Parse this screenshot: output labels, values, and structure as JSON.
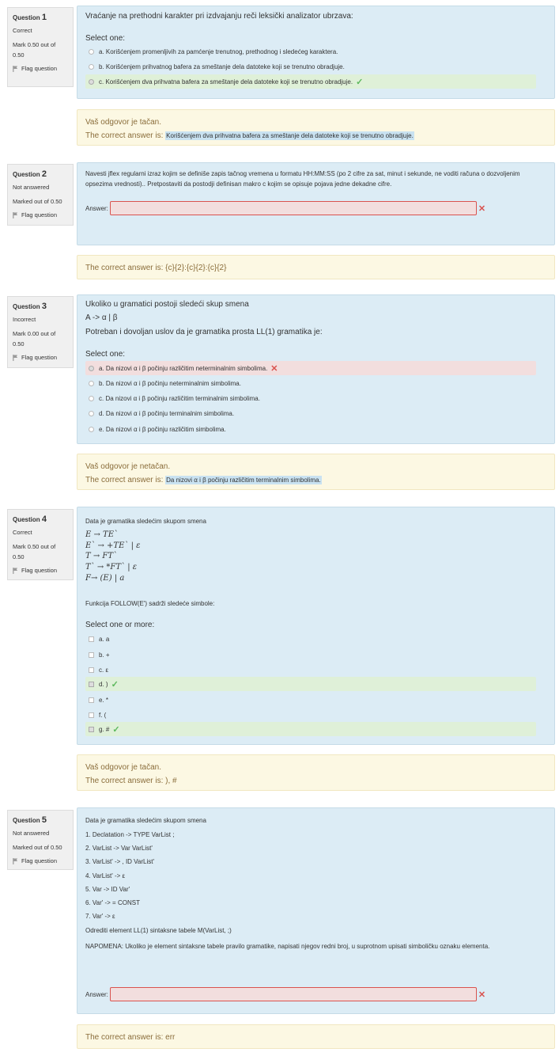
{
  "flag_label": "Flag question",
  "answer_label": "Answer:",
  "q1": {
    "label": "Question",
    "num": "1",
    "state": "Correct",
    "grade": "Mark 0.50 out of 0.50",
    "text": "Vraćanje na prethodni karakter pri izdvajanju reči leksički analizator ubrzava:",
    "select": "Select one:",
    "options": [
      "a. Korišćenjem promenljivih za pamćenje trenutnog, prethodnog i sledećeg karaktera.",
      "b. Korišćenjem prihvatnog bafera za smeštanje dela datoteke koji se trenutno obradjuje.",
      "c. Korišćenjem dva prihvatna bafera za smeštanje dela datoteke koji se trenutno obradjuje."
    ],
    "feedback": "Vaš odgovor je tačan.",
    "correct_prefix": "The correct answer is:",
    "correct": "Korišćenjem dva prihvatna bafera za smeštanje dela datoteke koji se trenutno obradjuje."
  },
  "q2": {
    "label": "Question",
    "num": "2",
    "state": "Not answered",
    "grade": "Marked out of 0.50",
    "text": "Navesti jflex regularni izraz kojim se definiše zapis tačnog vremena u formatu HH:MM:SS (po 2 cifre za sat, minut i sekunde, ne voditi računa o dozvoljenim opsezima vrednosti).. Pretpostaviti da postodji definisan makro c kojim se opisuje pojava jedne dekadne cifre.",
    "correct_full": "The correct answer is: {c}{2}:{c}{2}:{c}{2}"
  },
  "q3": {
    "label": "Question",
    "num": "3",
    "state": "Incorrect",
    "grade": "Mark 0.00 out of 0.50",
    "text1": "Ukoliko u gramatici postoji sledeći skup smena",
    "text2": "A -> α | β",
    "text3": "Potreban i dovoljan uslov da je gramatika prosta LL(1) gramatika je:",
    "select": "Select one:",
    "options": [
      "a. Da nizovi α i β počinju različitim neterminalnim simbolima.",
      "b. Da nizovi α i β počinju neterminalnim simbolima.",
      "c. Da nizovi α i β počinju različitim terminalnim simbolima.",
      "d. Da nizovi α i β počinju terminalnim simbolima.",
      "e. Da nizovi α i β počinju različitim simbolima."
    ],
    "feedback": "Vaš odgovor je netačan.",
    "correct_prefix": "The correct answer is:",
    "correct": "Da nizovi α i β počinju različitim terminalnim simbolima."
  },
  "q4": {
    "label": "Question",
    "num": "4",
    "state": "Correct",
    "grade": "Mark 0.50 out of 0.50",
    "intro": "Data je gramatika sledećim skupom smena",
    "rules": [
      "E → TE`",
      "E` → +TE` | ε",
      "T → FT`",
      "T` → *FT` | ε",
      "F→ (E) | a"
    ],
    "question": "Funkcija FOLLOW(E') sadrži sledeće simbole:",
    "select": "Select one or more:",
    "options": [
      "a. a",
      "b. +",
      "c. ε",
      "d. )",
      "e. *",
      "f. (",
      "g. #"
    ],
    "feedback": "Vaš odgovor je tačan.",
    "correct_full": "The correct answer is: ), #"
  },
  "q5": {
    "label": "Question",
    "num": "5",
    "state": "Not answered",
    "grade": "Marked out of 0.50",
    "intro": "Data je gramatika sledećim skupom smena",
    "rules": [
      "1. Declatation -> TYPE VarList ;",
      "2. VarList -> Var VarList'",
      "3.  VarList' -> , ID VarList'",
      "4. VarList' -> ε",
      "5. Var -> ID Var'",
      "6. Var' -> = CONST",
      "7.  Var' -> ε"
    ],
    "ask": "Odrediti element LL(1) sintaksne tabele M(VarList, ;)",
    "note": "NAPOMENA: Ukoliko je element sintaksne tabele pravilo gramatike, napisati njegov redni broj, u suprotnom upisati simboličku oznaku elementa.",
    "correct_full": "The correct answer is: err"
  }
}
